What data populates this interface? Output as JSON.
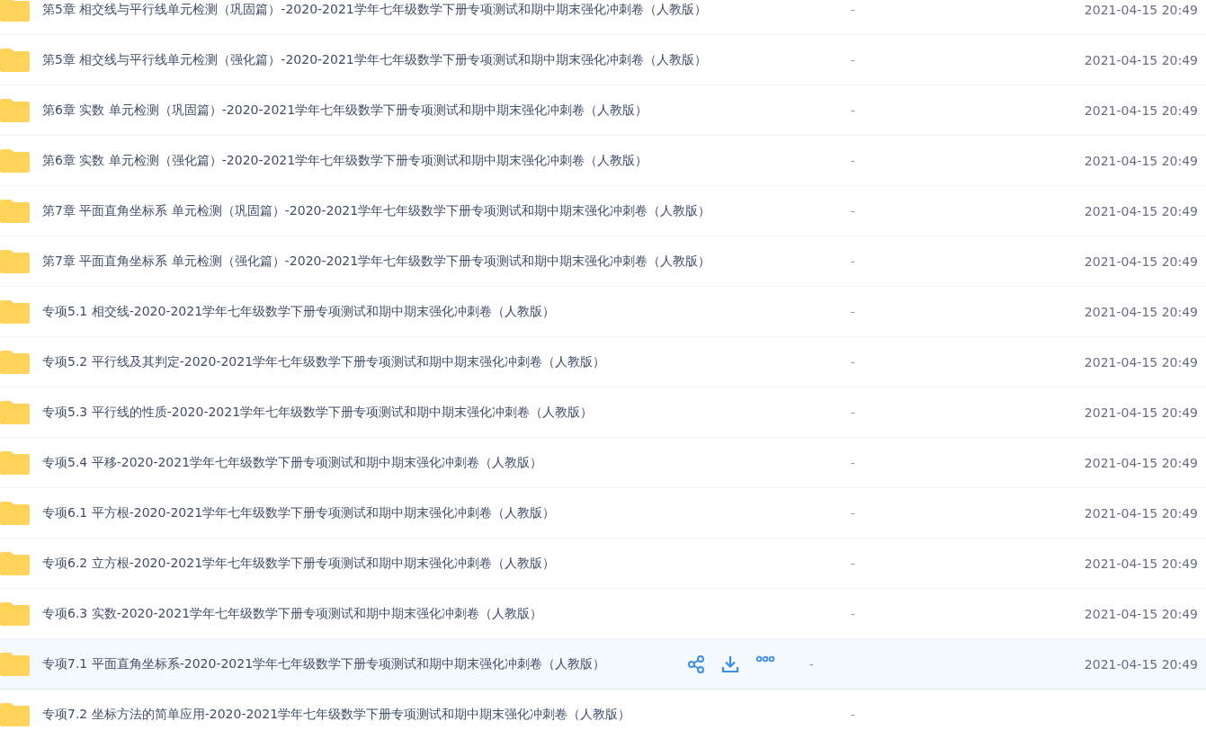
{
  "files": [
    {
      "name": "第5章 相交线与平行线单元检测（巩固篇）-2020-2021学年七年级数学下册专项测试和期中期末强化冲刺卷（人教版）",
      "size": "-",
      "modified": "2021-04-15 20:49",
      "hovered": false
    },
    {
      "name": "第5章 相交线与平行线单元检测（强化篇）-2020-2021学年七年级数学下册专项测试和期中期末强化冲刺卷（人教版）",
      "size": "-",
      "modified": "2021-04-15 20:49",
      "hovered": false
    },
    {
      "name": "第6章 实数 单元检测（巩固篇）-2020-2021学年七年级数学下册专项测试和期中期末强化冲刺卷（人教版）",
      "size": "-",
      "modified": "2021-04-15 20:49",
      "hovered": false
    },
    {
      "name": "第6章 实数 单元检测（强化篇）-2020-2021学年七年级数学下册专项测试和期中期末强化冲刺卷（人教版）",
      "size": "-",
      "modified": "2021-04-15 20:49",
      "hovered": false
    },
    {
      "name": "第7章 平面直角坐标系 单元检测（巩固篇）-2020-2021学年七年级数学下册专项测试和期中期末强化冲刺卷（人教版）",
      "size": "-",
      "modified": "2021-04-15 20:49",
      "hovered": false
    },
    {
      "name": "第7章 平面直角坐标系 单元检测（强化篇）-2020-2021学年七年级数学下册专项测试和期中期末强化冲刺卷（人教版）",
      "size": "-",
      "modified": "2021-04-15 20:49",
      "hovered": false
    },
    {
      "name": "专项5.1 相交线-2020-2021学年七年级数学下册专项测试和期中期末强化冲刺卷（人教版）",
      "size": "-",
      "modified": "2021-04-15 20:49",
      "hovered": false
    },
    {
      "name": "专项5.2 平行线及其判定-2020-2021学年七年级数学下册专项测试和期中期末强化冲刺卷（人教版）",
      "size": "-",
      "modified": "2021-04-15 20:49",
      "hovered": false
    },
    {
      "name": "专项5.3 平行线的性质-2020-2021学年七年级数学下册专项测试和期中期末强化冲刺卷（人教版）",
      "size": "-",
      "modified": "2021-04-15 20:49",
      "hovered": false
    },
    {
      "name": "专项5.4 平移-2020-2021学年七年级数学下册专项测试和期中期末强化冲刺卷（人教版）",
      "size": "-",
      "modified": "2021-04-15 20:49",
      "hovered": false
    },
    {
      "name": "专项6.1 平方根-2020-2021学年七年级数学下册专项测试和期中期末强化冲刺卷（人教版）",
      "size": "-",
      "modified": "2021-04-15 20:49",
      "hovered": false
    },
    {
      "name": "专项6.2 立方根-2020-2021学年七年级数学下册专项测试和期中期末强化冲刺卷（人教版）",
      "size": "-",
      "modified": "2021-04-15 20:49",
      "hovered": false
    },
    {
      "name": "专项6.3 实数-2020-2021学年七年级数学下册专项测试和期中期末强化冲刺卷（人教版）",
      "size": "-",
      "modified": "2021-04-15 20:49",
      "hovered": false
    },
    {
      "name": "专项7.1 平面直角坐标系-2020-2021学年七年级数学下册专项测试和期中期末强化冲刺卷（人教版）",
      "size": "-",
      "modified": "2021-04-15 20:49",
      "hovered": true
    },
    {
      "name": "专项7.2 坐标方法的简单应用-2020-2021学年七年级数学下册专项测试和期中期末强化冲刺卷（人教版）",
      "size": "-",
      "hovered": false
    }
  ]
}
